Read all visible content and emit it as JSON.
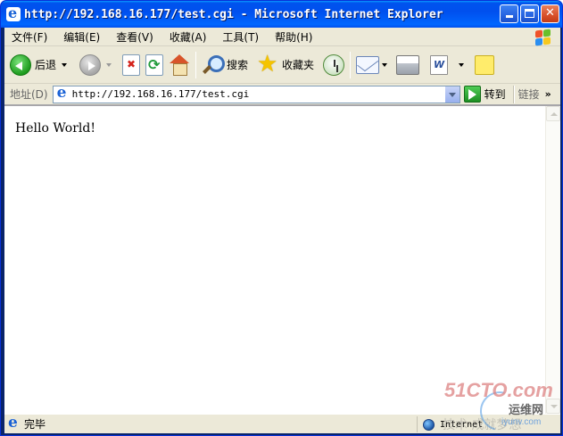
{
  "window": {
    "title": "http://192.168.16.177/test.cgi - Microsoft Internet Explorer"
  },
  "menu": {
    "items": [
      {
        "label": "文件(F)"
      },
      {
        "label": "编辑(E)"
      },
      {
        "label": "查看(V)"
      },
      {
        "label": "收藏(A)"
      },
      {
        "label": "工具(T)"
      },
      {
        "label": "帮助(H)"
      }
    ]
  },
  "toolbar": {
    "back_label": "后退",
    "search_label": "搜索",
    "favorites_label": "收藏夹"
  },
  "address": {
    "label": "地址(D)",
    "value": "http://192.168.16.177/test.cgi",
    "go_label": "转到",
    "links_label": "链接",
    "links_chevron": "»"
  },
  "content": {
    "text": "Hello World!"
  },
  "status": {
    "text": "完毕",
    "zone": "Internet"
  },
  "watermark": {
    "brand": "51CTO.com",
    "sub": "运维网",
    "url": "iyunv.com",
    "ghost": "技术·成就梦想"
  },
  "colors": {
    "titlebar": "#0053ee",
    "chrome": "#ece9d8",
    "close_button": "#d9502a"
  }
}
